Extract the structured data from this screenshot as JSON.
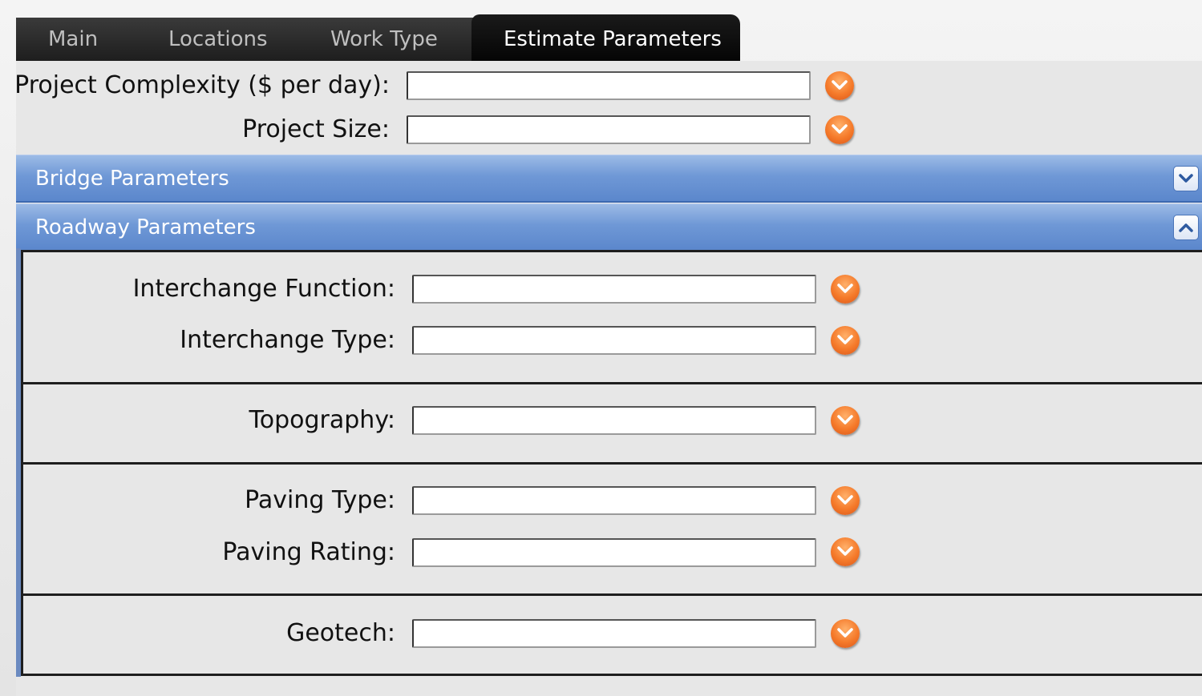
{
  "tabs": [
    {
      "label": "Main",
      "active": false
    },
    {
      "label": "Locations",
      "active": false
    },
    {
      "label": "Work Type",
      "active": false
    },
    {
      "label": "Estimate Parameters",
      "active": true
    }
  ],
  "general": {
    "project_complexity_label": "Project Complexity ($ per day):",
    "project_complexity_value": "",
    "project_size_label": "Project Size:",
    "project_size_value": ""
  },
  "sections": {
    "bridge": {
      "title": "Bridge Parameters",
      "expanded": false
    },
    "roadway": {
      "title": "Roadway Parameters",
      "expanded": true
    }
  },
  "roadway": {
    "interchange_function_label": "Interchange Function:",
    "interchange_function_value": "",
    "interchange_type_label": "Interchange Type:",
    "interchange_type_value": "",
    "topography_label": "Topography:",
    "topography_value": "",
    "paving_type_label": "Paving Type:",
    "paving_type_value": "",
    "paving_rating_label": "Paving Rating:",
    "paving_rating_value": "",
    "geotech_label": "Geotech:",
    "geotech_value": ""
  },
  "colors": {
    "accent_orange": "#f57a2a",
    "accordion_blue": "#6f98d6",
    "tab_dark": "#1e1e1e"
  },
  "icons": {
    "dropdown": "chevron-down-circle-icon",
    "collapse": "chevron-up-icon",
    "expand": "chevron-down-icon"
  }
}
